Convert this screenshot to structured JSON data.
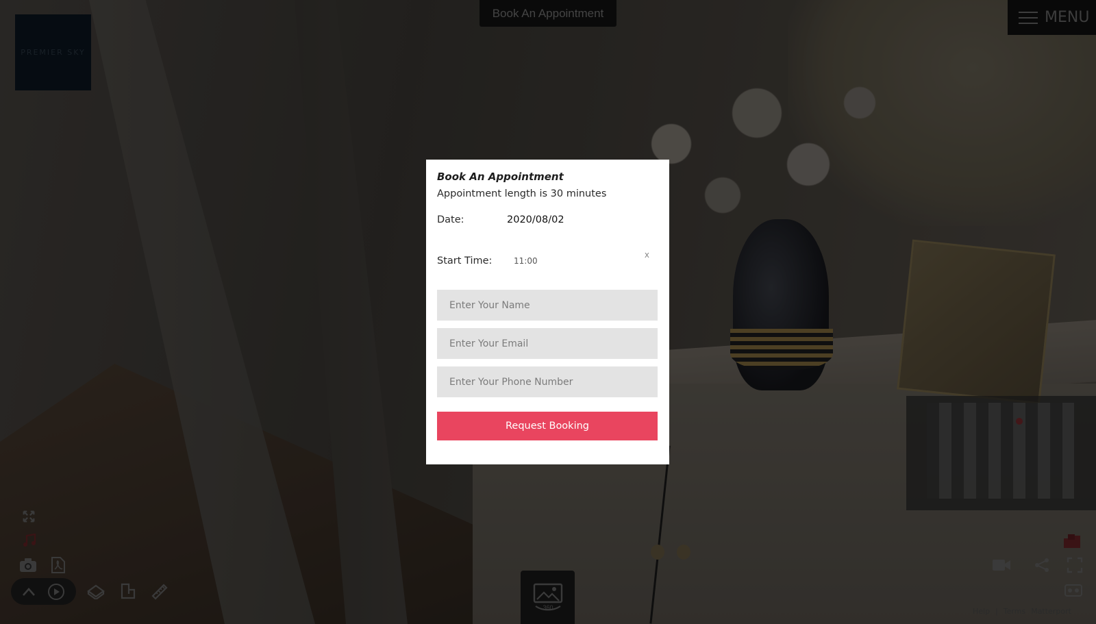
{
  "logo": {
    "text": "PREMIER SKY"
  },
  "header": {
    "book_button": "Book An Appointment",
    "menu_label": "MENU"
  },
  "modal": {
    "title": "Book An Appointment",
    "subtitle": "Appointment length is 30 minutes",
    "date_label": "Date:",
    "date_value": "2020/08/02",
    "start_time_label": "Start Time:",
    "start_time_value": "11:00",
    "clear_label": "x",
    "name_placeholder": "Enter Your Name",
    "email_placeholder": "Enter Your Email",
    "phone_placeholder": "Enter Your Phone Number",
    "submit_label": "Request Booking"
  },
  "footer": {
    "help": "Help",
    "terms": "Terms",
    "brand": "Matterport"
  },
  "colors": {
    "accent": "#e9455f",
    "overlay": "#000000",
    "modal_bg": "#ffffff",
    "field_bg": "#e3e3e3"
  },
  "icons": {
    "left_toolbar": [
      "collapse-icon",
      "music-icon",
      "camera-icon",
      "pdf-icon"
    ],
    "bottom_toolbar": [
      "chevron-up-icon",
      "play-icon",
      "dollhouse-icon",
      "floorplan-icon",
      "measure-icon"
    ],
    "right_toolbar": [
      "cube-icon",
      "video-icon",
      "share-icon",
      "fullscreen-icon",
      "vr-icon"
    ],
    "center": "panorama-360-icon"
  }
}
